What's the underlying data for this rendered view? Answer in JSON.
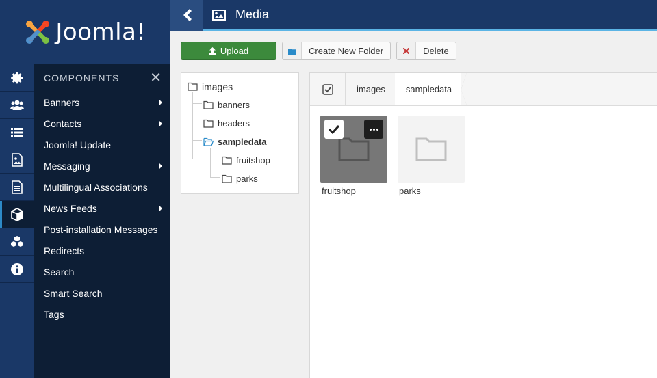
{
  "brand": {
    "name": "Joomla!"
  },
  "header": {
    "title": "Media",
    "back_icon": "chevron-left-icon",
    "title_icon": "image-icon"
  },
  "toolbar": {
    "upload_label": "Upload",
    "new_folder_label": "Create New Folder",
    "delete_label": "Delete"
  },
  "rail": [
    {
      "icon": "gear-icon"
    },
    {
      "icon": "users-icon"
    },
    {
      "icon": "list-icon"
    },
    {
      "icon": "image-file-icon"
    },
    {
      "icon": "document-icon"
    },
    {
      "icon": "cube-icon",
      "active": true
    },
    {
      "icon": "cubes-icon"
    },
    {
      "icon": "info-icon"
    }
  ],
  "menu": {
    "heading": "COMPONENTS",
    "items": [
      {
        "label": "Banners",
        "has_submenu": true
      },
      {
        "label": "Contacts",
        "has_submenu": true
      },
      {
        "label": "Joomla! Update",
        "has_submenu": false
      },
      {
        "label": "Messaging",
        "has_submenu": true
      },
      {
        "label": "Multilingual Associations",
        "has_submenu": false
      },
      {
        "label": "News Feeds",
        "has_submenu": true
      },
      {
        "label": "Post-installation Messages",
        "has_submenu": false
      },
      {
        "label": "Redirects",
        "has_submenu": false
      },
      {
        "label": "Search",
        "has_submenu": false
      },
      {
        "label": "Smart Search",
        "has_submenu": false
      },
      {
        "label": "Tags",
        "has_submenu": false
      }
    ]
  },
  "tree": {
    "root": "images",
    "children": [
      {
        "label": "banners"
      },
      {
        "label": "headers"
      },
      {
        "label": "sampledata",
        "open": true,
        "children": [
          {
            "label": "fruitshop"
          },
          {
            "label": "parks"
          }
        ]
      }
    ]
  },
  "breadcrumb": [
    "images",
    "sampledata"
  ],
  "files": [
    {
      "name": "fruitshop",
      "selected": true
    },
    {
      "name": "parks",
      "selected": false
    }
  ],
  "colors": {
    "sidebar": "#1a3867",
    "menu": "#0d1e35",
    "accent": "#5bb4e5",
    "upload": "#3c8a3c"
  }
}
